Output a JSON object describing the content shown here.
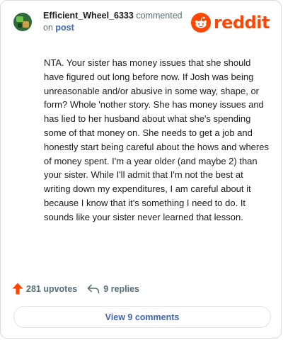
{
  "header": {
    "username": "Efficient_Wheel_6333",
    "action_text": "commented",
    "on_text": "on",
    "post_link": "post"
  },
  "logo": {
    "text": "reddit",
    "icon": "reddit-alien-icon",
    "color": "#ff4500"
  },
  "comment": {
    "body": "NTA. Your sister has money issues that she should have figured out long before now. If Josh was being unreasonable and/or abusive in some way, shape, or form? Whole 'nother story. She has money issues and has lied to her husband about what she's spending some of that money on. She needs to get a job and honestly start being careful about the hows and wheres of money spent. I'm a year older (and maybe 2) than your sister. While I'll admit that I'm not the best at writing down my expenditures, I am careful about it because I know that it's something I need to do. It sounds like your sister never learned that lesson."
  },
  "stats": {
    "upvotes": "281 upvotes",
    "upvote_icon": "upvote-arrow-icon",
    "replies": "9 replies",
    "reply_icon": "reply-arrow-icon"
  },
  "footer": {
    "view_comments": "View 9 comments"
  },
  "colors": {
    "accent": "#ff4500",
    "link": "#3f63b5",
    "muted": "#576f76",
    "text": "#1c1c1c"
  }
}
